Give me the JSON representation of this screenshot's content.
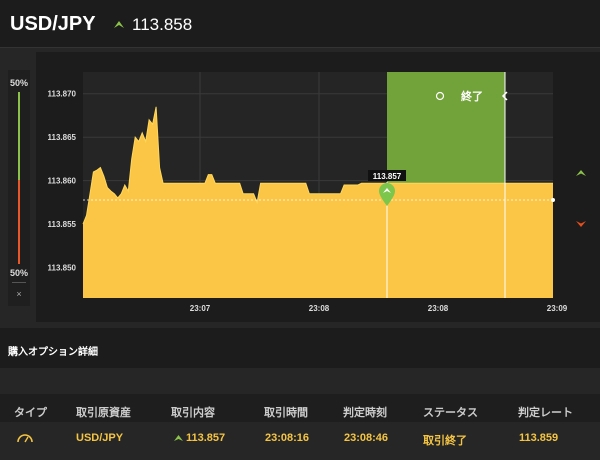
{
  "header": {
    "pair": "USD/JPY",
    "price": "113.858",
    "direction_icon": "arrow-up-icon"
  },
  "gauge": {
    "top_label": "50%",
    "bottom_label": "50%",
    "close_label": "×"
  },
  "chart": {
    "end_label": "終了",
    "current_marker": "113.857",
    "ytick_labels": [
      "113.870",
      "113.865",
      "113.860",
      "113.855",
      "113.850"
    ],
    "xtick_labels": [
      "23:07",
      "23:08",
      "23:08",
      "23:09"
    ],
    "colors": {
      "fill": "#fbc646",
      "zone": "#72a23a",
      "marker": "#7cc64b",
      "up": "#8bc34a",
      "down": "#e84e1c"
    }
  },
  "chart_data": {
    "type": "area",
    "ylim": [
      113.8465,
      113.8725
    ],
    "series": [
      {
        "values": [
          113.855,
          113.856,
          113.8585,
          113.861,
          113.8612,
          113.8615,
          113.8605,
          113.8592,
          113.8588,
          113.8585,
          113.858,
          113.8585,
          113.8595,
          113.8588,
          113.8625,
          113.865,
          113.8645,
          113.8655,
          113.8645,
          113.867,
          113.8665,
          113.8685,
          113.8615,
          113.8597,
          113.8597,
          113.8597,
          113.8597,
          113.8597,
          113.8597,
          113.8597,
          113.8597,
          113.8597,
          113.8597,
          113.8597,
          113.8597,
          113.8597,
          113.8607,
          113.8607,
          113.8597,
          113.8597,
          113.8597,
          113.8597,
          113.8597,
          113.8597,
          113.8597,
          113.8597,
          113.8585,
          113.8585,
          113.8585,
          113.8585,
          113.8575,
          113.8597,
          113.8597,
          113.8597,
          113.8597,
          113.8597,
          113.8597,
          113.8597,
          113.8597,
          113.8597,
          113.8597,
          113.8597,
          113.8597,
          113.8597,
          113.8597,
          113.8585,
          113.8585,
          113.8585,
          113.8585,
          113.8585,
          113.8585,
          113.8585,
          113.8585,
          113.8585,
          113.8585,
          113.8595,
          113.8595,
          113.8595,
          113.8595,
          113.8595,
          113.8597,
          113.8597,
          113.8597,
          113.8597,
          113.8597,
          113.8597,
          113.8597,
          113.8597,
          113.8597,
          113.8597,
          113.8597,
          113.8597,
          113.8597,
          113.8597,
          113.8597,
          113.8597,
          113.8597,
          113.8597,
          113.8597,
          113.8597,
          113.8597,
          113.8597,
          113.8597,
          113.8597,
          113.8597,
          113.8597,
          113.8597,
          113.8597,
          113.8597,
          113.8597,
          113.8597,
          113.8597,
          113.8597,
          113.8597,
          113.8597,
          113.8597,
          113.8597,
          113.8597,
          113.8597,
          113.8597,
          113.8597,
          113.8597,
          113.8597,
          113.8597,
          113.8597,
          113.8597,
          113.8597,
          113.8597,
          113.8597,
          113.8597,
          113.8597,
          113.8597,
          113.8597,
          113.8597,
          113.8597,
          113.8597
        ]
      }
    ]
  },
  "details": {
    "title": "購入オプション詳細"
  },
  "table": {
    "headers": [
      "タイプ",
      "取引原資産",
      "取引内容",
      "取引時間",
      "判定時刻",
      "ステータス",
      "判定レート"
    ],
    "row": {
      "type_icon": "gauge-icon",
      "asset": "USD/JPY",
      "content": "113.857",
      "trade_time": "23:08:16",
      "judge_time": "23:08:46",
      "status": "取引終了",
      "rate": "113.859"
    }
  }
}
